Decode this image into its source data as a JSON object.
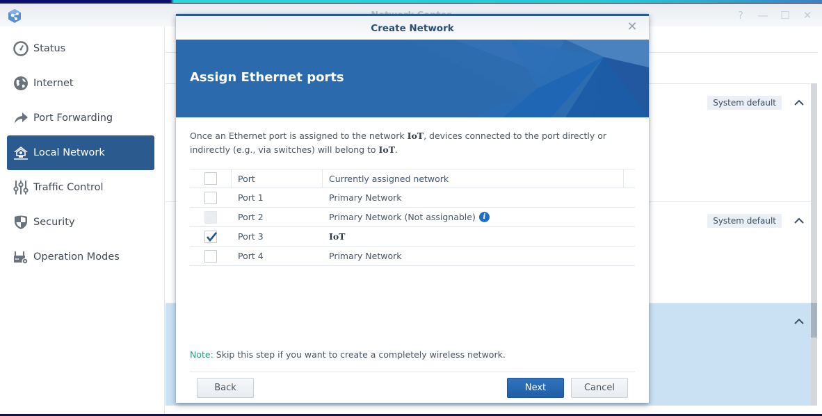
{
  "window": {
    "title": "Network Center",
    "controls": [
      {
        "name": "help",
        "glyph": "?"
      },
      {
        "name": "minimize",
        "glyph": "—"
      },
      {
        "name": "maximize",
        "glyph": "☐"
      },
      {
        "name": "close",
        "glyph": "✕"
      }
    ]
  },
  "sidebar": {
    "items": [
      {
        "label": "Status",
        "icon": "gauge-icon",
        "active": false
      },
      {
        "label": "Internet",
        "icon": "globe-icon",
        "active": false
      },
      {
        "label": "Port Forwarding",
        "icon": "forward-arrow-icon",
        "active": false
      },
      {
        "label": "Local Network",
        "icon": "home-network-icon",
        "active": true
      },
      {
        "label": "Traffic Control",
        "icon": "sliders-icon",
        "active": false
      },
      {
        "label": "Security",
        "icon": "shield-icon",
        "active": false
      },
      {
        "label": "Operation Modes",
        "icon": "router-gear-icon",
        "active": false
      }
    ]
  },
  "background_panels": [
    {
      "badge": "System default",
      "expanded": true
    },
    {
      "badge": "System default",
      "expanded": true
    },
    {
      "badge": "",
      "expanded": true,
      "selected": true
    }
  ],
  "dialog": {
    "title": "Create Network",
    "banner_title": "Assign Ethernet ports",
    "description": {
      "part1": "Once an Ethernet port is assigned to the network ",
      "network1": "IoT",
      "part2": ", devices connected to the port directly or indirectly (e.g., via switches) will belong to ",
      "network2": "IoT",
      "part3": "."
    },
    "table": {
      "headers": {
        "select_all": false,
        "port": "Port",
        "network": "Currently assigned network"
      },
      "rows": [
        {
          "port": "Port 1",
          "network": "Primary Network",
          "checked": false,
          "disabled": false,
          "bold": false,
          "info": false
        },
        {
          "port": "Port 2",
          "network": "Primary Network (Not assignable)",
          "checked": false,
          "disabled": true,
          "bold": false,
          "info": true
        },
        {
          "port": "Port 3",
          "network": "IoT",
          "checked": true,
          "disabled": false,
          "bold": true,
          "info": false
        },
        {
          "port": "Port 4",
          "network": "Primary Network",
          "checked": false,
          "disabled": false,
          "bold": false,
          "info": false
        }
      ]
    },
    "note_label": "Note:",
    "note_text": " Skip this step if you want to create a completely wireless network.",
    "buttons": {
      "back": "Back",
      "next": "Next",
      "cancel": "Cancel"
    }
  },
  "colors": {
    "accent": "#2b5a8e",
    "banner": "#2c6aae",
    "primary_button": "#2467b0",
    "note_label": "#2a9a80",
    "info_icon": "#1d6fc2",
    "selected_panel": "#cae1f4"
  }
}
